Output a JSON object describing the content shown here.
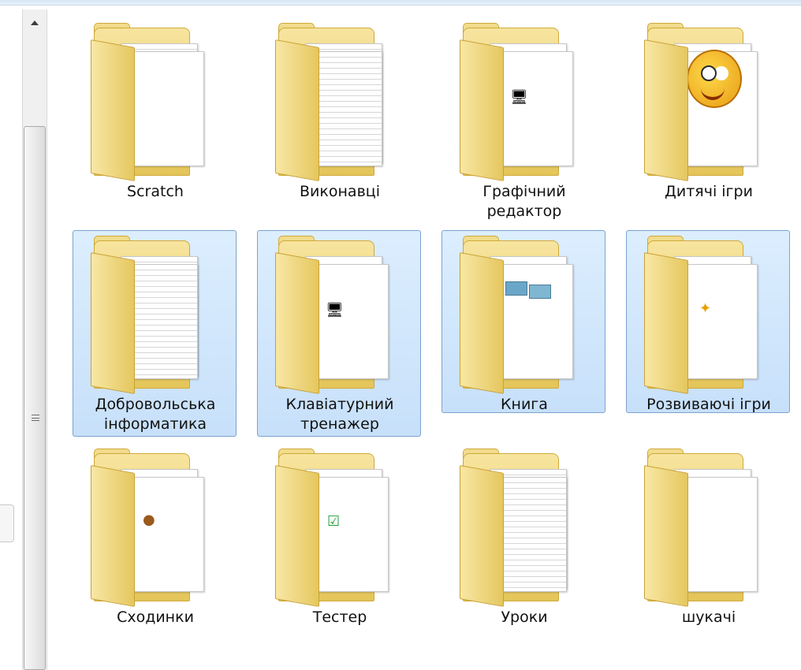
{
  "folders": [
    {
      "label": "Scratch",
      "selected": false,
      "content": "lined-docs"
    },
    {
      "label": "Виконавці",
      "selected": false,
      "content": "stacked-docs"
    },
    {
      "label": "Графічний редактор",
      "selected": false,
      "content": "app-icon"
    },
    {
      "label": "Дитячі ігри",
      "selected": false,
      "content": "cartoon-hand"
    },
    {
      "label": "Добровольська інформатика",
      "selected": true,
      "content": "stacked-docs"
    },
    {
      "label": "Клавіатурний тренажер",
      "selected": true,
      "content": "app-icon"
    },
    {
      "label": "Книга",
      "selected": true,
      "content": "image-docs"
    },
    {
      "label": "Розвиваючі ігри",
      "selected": true,
      "content": "orange-icon"
    },
    {
      "label": "Сходинки",
      "selected": false,
      "content": "acorn-icon"
    },
    {
      "label": "Тестер",
      "selected": false,
      "content": "green-icon"
    },
    {
      "label": "Уроки",
      "selected": false,
      "content": "stacked-docs"
    },
    {
      "label": "шукачі",
      "selected": false,
      "content": "plain-docs"
    }
  ]
}
